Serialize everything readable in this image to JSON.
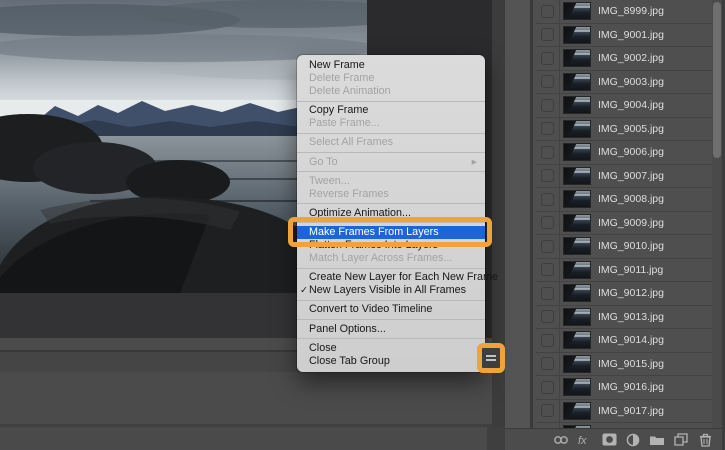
{
  "colors": {
    "annotation_orange": "#f0a23b",
    "menu_highlight_blue": "#1c64d8"
  },
  "timeline_menu": {
    "items": [
      {
        "type": "item",
        "label": "New Frame",
        "enabled": true
      },
      {
        "type": "item",
        "label": "Delete Frame",
        "enabled": false
      },
      {
        "type": "item",
        "label": "Delete Animation",
        "enabled": false
      },
      {
        "type": "separator"
      },
      {
        "type": "item",
        "label": "Copy Frame",
        "enabled": true
      },
      {
        "type": "item",
        "label": "Paste Frame...",
        "enabled": false
      },
      {
        "type": "separator"
      },
      {
        "type": "item",
        "label": "Select All Frames",
        "enabled": false
      },
      {
        "type": "separator"
      },
      {
        "type": "item",
        "label": "Go To",
        "enabled": false,
        "submenu": true
      },
      {
        "type": "separator"
      },
      {
        "type": "item",
        "label": "Tween...",
        "enabled": false
      },
      {
        "type": "item",
        "label": "Reverse Frames",
        "enabled": false
      },
      {
        "type": "separator"
      },
      {
        "type": "item",
        "label": "Optimize Animation...",
        "enabled": true
      },
      {
        "type": "separator"
      },
      {
        "type": "item",
        "label": "Make Frames From Layers",
        "enabled": true,
        "highlighted": true,
        "annotated": true
      },
      {
        "type": "item",
        "label": "Flatten Frames Into Layers",
        "enabled": true
      },
      {
        "type": "item",
        "label": "Match Layer Across Frames...",
        "enabled": false
      },
      {
        "type": "separator"
      },
      {
        "type": "item",
        "label": "Create New Layer for Each New Frame",
        "enabled": true
      },
      {
        "type": "item",
        "label": "New Layers Visible in All Frames",
        "enabled": true,
        "checked": true
      },
      {
        "type": "separator"
      },
      {
        "type": "item",
        "label": "Convert to Video Timeline",
        "enabled": true
      },
      {
        "type": "separator"
      },
      {
        "type": "item",
        "label": "Panel Options...",
        "enabled": true
      },
      {
        "type": "separator"
      },
      {
        "type": "item",
        "label": "Close",
        "enabled": true
      },
      {
        "type": "item",
        "label": "Close Tab Group",
        "enabled": true
      }
    ]
  },
  "timeline_panel": {
    "menu_button_icon": "panel-menu-icon",
    "menu_button_annotated": true
  },
  "layers_panel": {
    "layers": [
      {
        "name": "IMG_8999.jpg",
        "visible": false
      },
      {
        "name": "IMG_9001.jpg",
        "visible": false
      },
      {
        "name": "IMG_9002.jpg",
        "visible": false
      },
      {
        "name": "IMG_9003.jpg",
        "visible": false
      },
      {
        "name": "IMG_9004.jpg",
        "visible": false
      },
      {
        "name": "IMG_9005.jpg",
        "visible": false
      },
      {
        "name": "IMG_9006.jpg",
        "visible": false
      },
      {
        "name": "IMG_9007.jpg",
        "visible": false
      },
      {
        "name": "IMG_9008.jpg",
        "visible": false
      },
      {
        "name": "IMG_9009.jpg",
        "visible": false
      },
      {
        "name": "IMG_9010.jpg",
        "visible": false
      },
      {
        "name": "IMG_9011.jpg",
        "visible": false
      },
      {
        "name": "IMG_9012.jpg",
        "visible": false
      },
      {
        "name": "IMG_9013.jpg",
        "visible": false
      },
      {
        "name": "IMG_9014.jpg",
        "visible": false
      },
      {
        "name": "IMG_9015.jpg",
        "visible": false
      },
      {
        "name": "IMG_9016.jpg",
        "visible": false
      },
      {
        "name": "IMG_9017.jpg",
        "visible": false
      }
    ],
    "has_partial_row": true,
    "bottom_toolbar_icons": [
      "link-icon",
      "fx-icon",
      "layer-mask-icon",
      "adjustment-layer-icon",
      "group-folder-icon",
      "new-layer-icon",
      "delete-layer-icon"
    ]
  }
}
